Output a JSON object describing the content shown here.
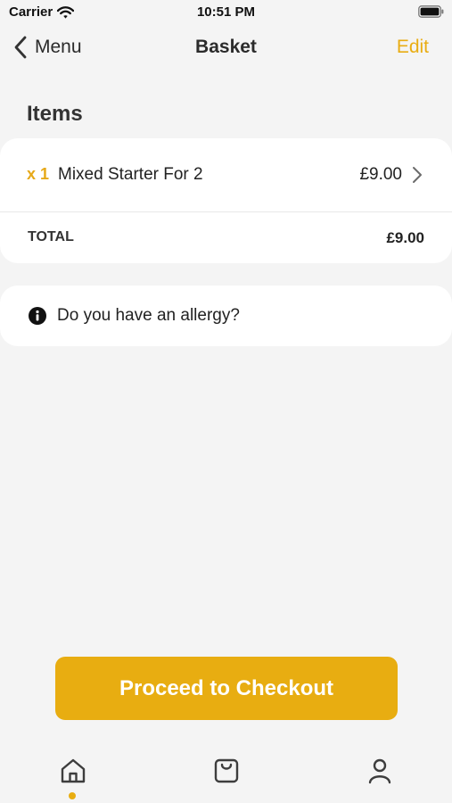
{
  "status_bar": {
    "carrier": "Carrier",
    "time": "10:51 PM"
  },
  "nav": {
    "back_label": "Menu",
    "title": "Basket",
    "edit_label": "Edit"
  },
  "items": {
    "heading": "Items",
    "list": [
      {
        "quantity": "x 1",
        "name": "Mixed Starter For 2",
        "price": "£9.00"
      }
    ],
    "total_label": "TOTAL",
    "total_value": "£9.00"
  },
  "allergy": {
    "text": "Do you have an allergy?"
  },
  "checkout": {
    "label": "Proceed to Checkout"
  },
  "tabs": [
    {
      "icon": "home-icon",
      "active": true
    },
    {
      "icon": "basket-icon",
      "active": false
    },
    {
      "icon": "account-icon",
      "active": false
    }
  ],
  "colors": {
    "accent": "#e8ad11",
    "background": "#f4f4f4",
    "card": "#ffffff"
  }
}
